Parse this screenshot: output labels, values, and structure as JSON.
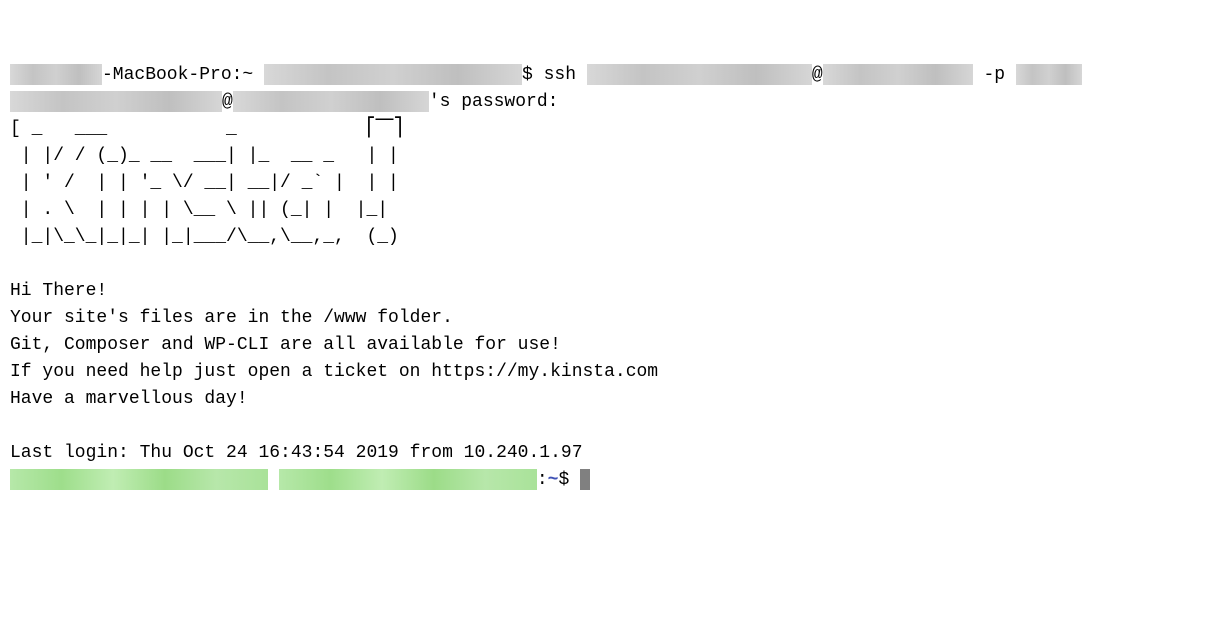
{
  "line1": {
    "hostname_suffix": "-MacBook-Pro:~ ",
    "prompt_dollar": "$ ssh ",
    "at": "@",
    "port_flag": " -p "
  },
  "line2": {
    "at": "@",
    "label": "'s password:"
  },
  "ascii_art": "[ _   ___           _            ⎡⎺⎤\n | |/ / (_)_ __  ___| |_  __ _   | |\n | ' /  | | '_ \\/ __| __|/ _` |  | |\n | . \\  | | | | \\__ \\ || (_| |  |_|\n |_|\\_\\_|_|_| |_|___/\\__,\\__,_,  (_)",
  "greeting": "Hi There!",
  "msg_files": "Your site's files are in the /www folder.",
  "msg_tools": "Git, Composer and WP-CLI are all available for use!",
  "msg_help": "If you need help just open a ticket on https://my.kinsta.com",
  "msg_day": "Have a marvellous day!",
  "last_login": "Last login: Thu Oct 24 16:43:54 2019 from 10.240.1.97",
  "remote_prompt": {
    "colon": ":",
    "tilde": "~",
    "dollar": "$ "
  }
}
